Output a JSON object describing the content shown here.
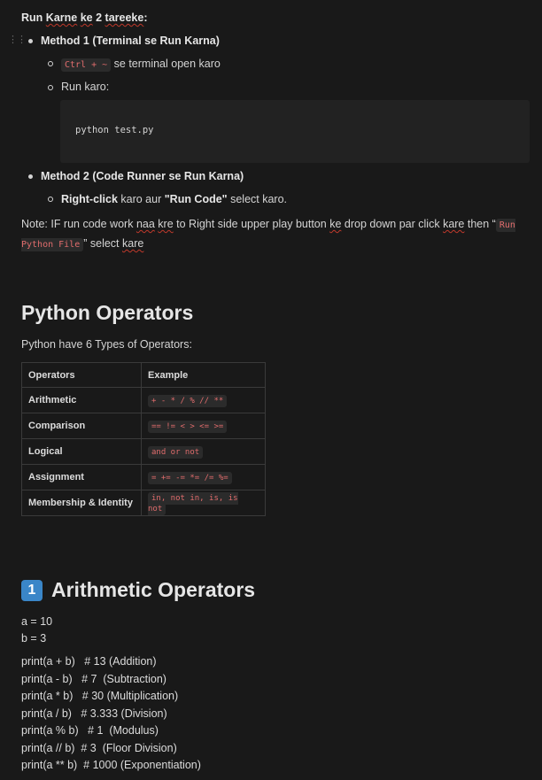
{
  "run": {
    "heading_run": "Run",
    "heading_karne": "Karne",
    "heading_ke": "ke",
    "heading_num": "2",
    "heading_tareeke": "tareeke",
    "heading_colon": ":",
    "method1": "Method 1 (Terminal se Run Karna)",
    "shortcut": "Ctrl + ~",
    "shortcut_text": "se terminal open karo",
    "run_karo": "Run karo:",
    "code": "python test.py",
    "method2": "Method 2 (Code Runner se Run Karna)",
    "right_click": "Right-click",
    "m2_text_a": "karo aur",
    "run_code_label": "\"Run Code\"",
    "m2_text_b": "select karo."
  },
  "note": {
    "part1": "Note: IF run code work",
    "naa": "naa",
    "kre1": "kre",
    "part2": "to Right side upper play button",
    "ke": "ke",
    "part3": "drop down par click",
    "kare1": "kare",
    "part4": "then “",
    "code": "Run Python File",
    "part5": "” select",
    "kare2": "kare"
  },
  "operators": {
    "title": "Python Operators",
    "subtitle": "Python have 6 Types of Operators:",
    "headers": [
      "Operators",
      "Example"
    ],
    "rows": [
      {
        "name": "Arithmetic",
        "example": "+ - * / % // **"
      },
      {
        "name": "Comparison",
        "example": "== != < > <= >="
      },
      {
        "name": "Logical",
        "example": "and or not"
      },
      {
        "name": "Assignment",
        "example": "= += -= *= /= %="
      },
      {
        "name": "Membership & Identity",
        "example": "in, not in, is, is not"
      }
    ]
  },
  "arith": {
    "icon_label": "1",
    "title": "Arithmetic Operators",
    "vars": [
      "a = 10",
      "b = 3"
    ],
    "prints": [
      "print(a + b)   # 13 (Addition)",
      "print(a - b)   # 7  (Subtraction)",
      "print(a * b)   # 30 (Multiplication)",
      "print(a / b)   # 3.333 (Division)",
      "print(a % b)   # 1  (Modulus)",
      "print(a // b)  # 3  (Floor Division)",
      "print(a ** b)  # 1000 (Exponentiation)"
    ]
  }
}
